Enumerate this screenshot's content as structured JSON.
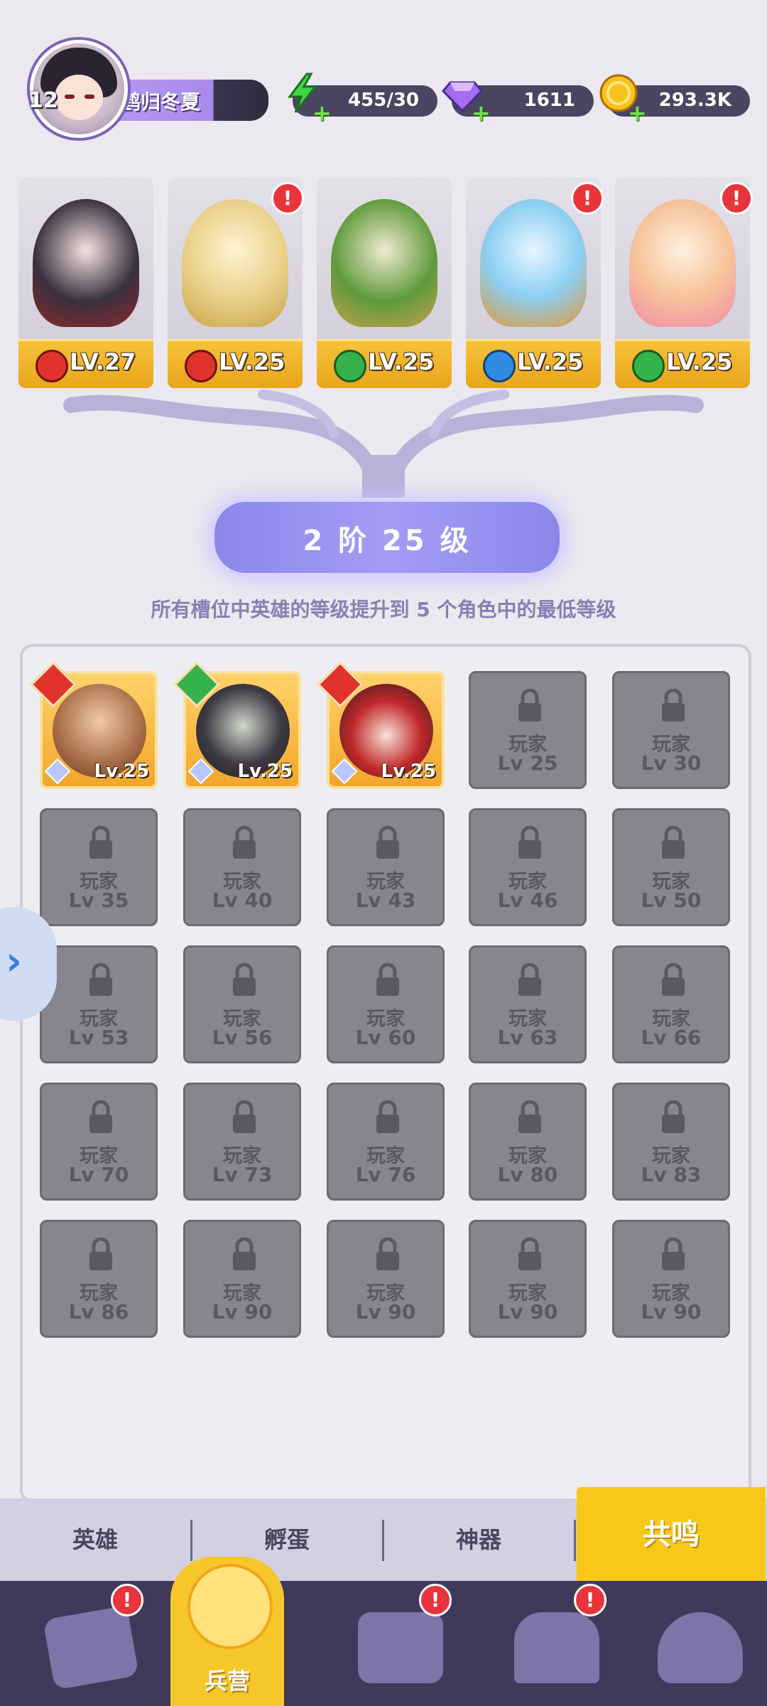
{
  "player": {
    "level": "12",
    "name": "鹤归冬夏"
  },
  "resources": {
    "energy": "455/30",
    "gems": "1611",
    "coins": "293.3K"
  },
  "heroes": [
    {
      "level": "LV.27",
      "element_color": "#e0332b",
      "alert": false
    },
    {
      "level": "LV.25",
      "element_color": "#e0332b",
      "alert": true
    },
    {
      "level": "LV.25",
      "element_color": "#36b24a",
      "alert": false
    },
    {
      "level": "LV.25",
      "element_color": "#2f8ce0",
      "alert": true
    },
    {
      "level": "LV.25",
      "element_color": "#36b24a",
      "alert": true
    }
  ],
  "rank": {
    "title": "2 阶 25 级",
    "description": "所有槽位中英雄的等级提升到 5 个角色中的最低等级"
  },
  "hero_slots": [
    {
      "level": "Lv.25",
      "element_color": "#e0332b"
    },
    {
      "level": "Lv.25",
      "element_color": "#36b24a"
    },
    {
      "level": "Lv.25",
      "element_color": "#e0332b"
    }
  ],
  "locked_slots": {
    "label": "玩家",
    "levels": [
      "Lv 25",
      "Lv 30",
      "Lv 35",
      "Lv 40",
      "Lv 43",
      "Lv 46",
      "Lv 50",
      "Lv 53",
      "Lv 56",
      "Lv 60",
      "Lv 63",
      "Lv 66",
      "Lv 70",
      "Lv 73",
      "Lv 76",
      "Lv 80",
      "Lv 83",
      "Lv 86",
      "Lv 90",
      "Lv 90",
      "Lv 90",
      "Lv 90"
    ]
  },
  "sub_tabs": [
    "英雄",
    "孵蛋",
    "神器"
  ],
  "active_sub_tab": "共鸣",
  "nav": {
    "active_label": "兵营",
    "alert": "!"
  },
  "colors": {
    "accent": "#f8c818",
    "locked": "#88858e",
    "rank": "#a49cf5"
  }
}
